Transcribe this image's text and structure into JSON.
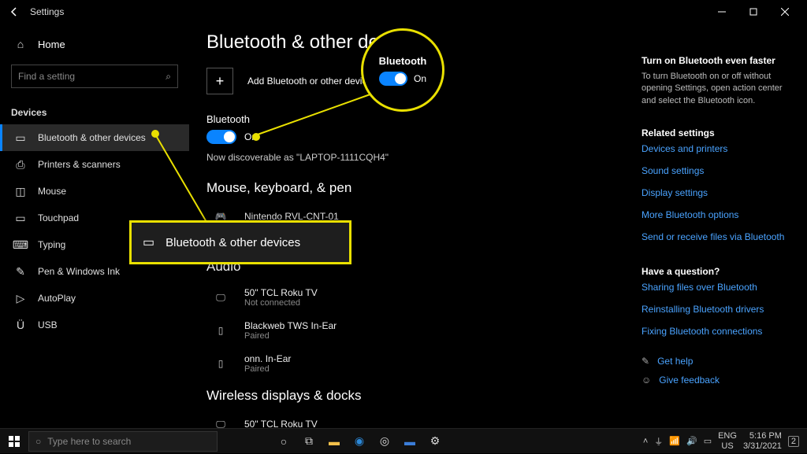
{
  "titlebar": {
    "title": "Settings"
  },
  "sidebar": {
    "home": "Home",
    "search_placeholder": "Find a setting",
    "section": "Devices",
    "items": [
      {
        "label": "Bluetooth & other devices",
        "active": true
      },
      {
        "label": "Printers & scanners"
      },
      {
        "label": "Mouse"
      },
      {
        "label": "Touchpad"
      },
      {
        "label": "Typing"
      },
      {
        "label": "Pen & Windows Ink"
      },
      {
        "label": "AutoPlay"
      },
      {
        "label": "USB"
      }
    ]
  },
  "main": {
    "page_title": "Bluetooth & other devices",
    "add_label": "Add Bluetooth or other device",
    "bt_label": "Bluetooth",
    "bt_state": "On",
    "discoverable": "Now discoverable as \"LAPTOP-1111CQH4\"",
    "sections": {
      "mouse": "Mouse, keyboard, & pen",
      "audio": "Audio",
      "wireless": "Wireless displays & docks"
    },
    "devices": {
      "mouse": [
        {
          "name": "Nintendo RVL-CNT-01"
        }
      ],
      "audio": [
        {
          "name": "50\" TCL Roku TV",
          "sub": "Not connected"
        },
        {
          "name": "Blackweb TWS In-Ear",
          "sub": "Paired"
        },
        {
          "name": "onn. In-Ear",
          "sub": "Paired"
        }
      ],
      "wireless": [
        {
          "name": "50\" TCL Roku TV"
        }
      ]
    }
  },
  "right": {
    "head1": "Turn on Bluetooth even faster",
    "body1": "To turn Bluetooth on or off without opening Settings, open action center and select the Bluetooth icon.",
    "head2": "Related settings",
    "links1": [
      "Devices and printers",
      "Sound settings",
      "Display settings",
      "More Bluetooth options",
      "Send or receive files via Bluetooth"
    ],
    "head3": "Have a question?",
    "links2": [
      "Sharing files over Bluetooth",
      "Reinstalling Bluetooth drivers",
      "Fixing Bluetooth connections"
    ],
    "get_help": "Get help",
    "feedback": "Give feedback"
  },
  "callout": {
    "box_label": "Bluetooth & other devices",
    "circle_label": "Bluetooth",
    "circle_state": "On"
  },
  "taskbar": {
    "search_placeholder": "Type here to search",
    "lang1": "ENG",
    "lang2": "US",
    "time": "5:16 PM",
    "date": "3/31/2021",
    "notif_count": "2"
  }
}
